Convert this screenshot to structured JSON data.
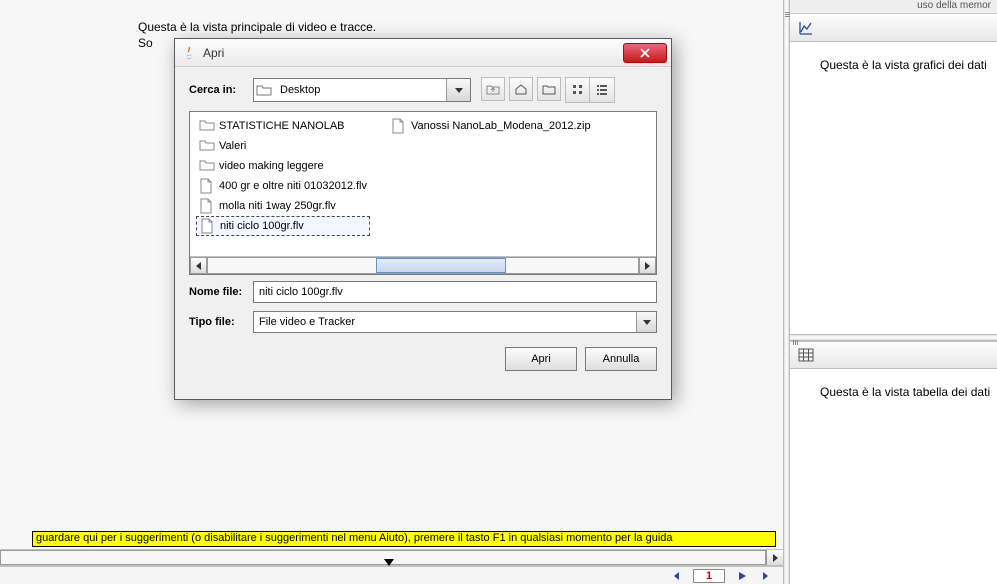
{
  "main": {
    "text": "Questa è la vista principale di video e tracce.",
    "text2": "So"
  },
  "dialog": {
    "title": "Apri",
    "lookin_label": "Cerca in:",
    "lookin_value": "Desktop",
    "filename_label": "Nome file:",
    "filename_value": "niti ciclo 100gr.flv",
    "filetype_label": "Tipo file:",
    "filetype_value": "File video e Tracker",
    "open_btn": "Apri",
    "cancel_btn": "Annulla",
    "files": [
      {
        "name": "STATISTICHE NANOLAB",
        "type": "folder"
      },
      {
        "name": "Valeri",
        "type": "folder"
      },
      {
        "name": "video making leggere",
        "type": "folder"
      },
      {
        "name": "400 gr e oltre niti 01032012.flv",
        "type": "file"
      },
      {
        "name": "molla  niti 1way 250gr.flv",
        "type": "file"
      },
      {
        "name": "niti ciclo 100gr.flv",
        "type": "file",
        "selected": true
      },
      {
        "name": "Vanossi NanoLab_Modena_2012.zip",
        "type": "file"
      }
    ]
  },
  "right": {
    "top_text": "uso della memor",
    "chart_text": "Questa è la vista grafici dei dati",
    "table_text": "Questa è la vista tabella dei dati"
  },
  "hint": "guardare qui per i suggerimenti (o disabilitare i suggerimenti nel menu Aiuto), premere il tasto F1 in qualsiasi momento per la guida",
  "player": {
    "frame": "1"
  }
}
